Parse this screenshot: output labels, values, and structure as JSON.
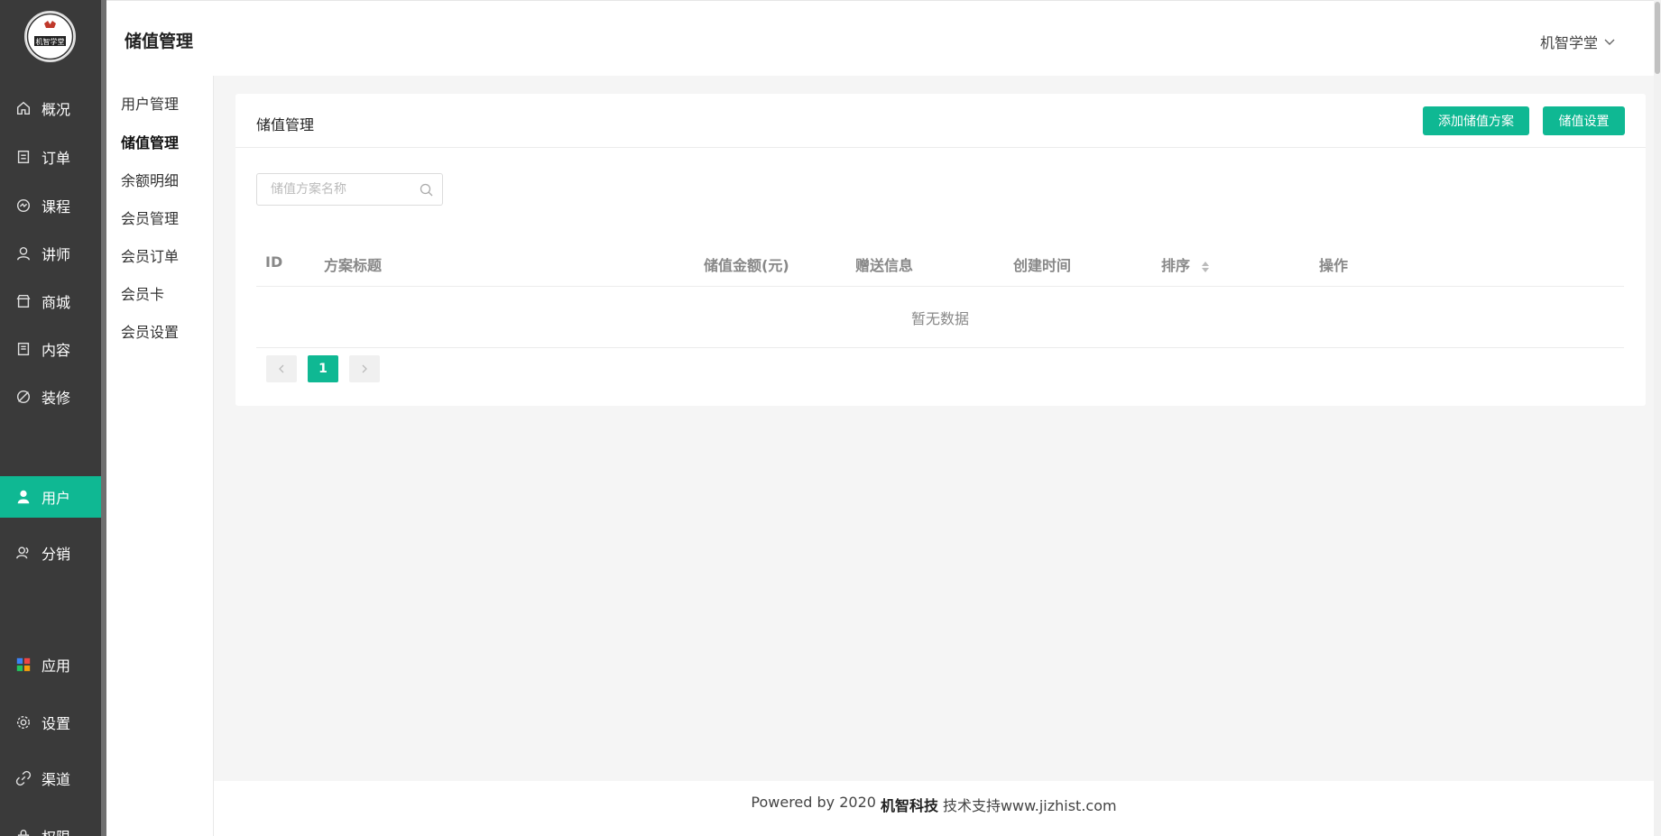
{
  "brand": {
    "logo_text": "机智学堂",
    "accent_color": "#0fb893",
    "nav_bg": "#3a3a3a"
  },
  "nav": {
    "items": [
      {
        "label": "概况",
        "icon": "home-icon"
      },
      {
        "label": "订单",
        "icon": "order-icon"
      },
      {
        "label": "课程",
        "icon": "course-icon"
      },
      {
        "label": "讲师",
        "icon": "teacher-icon"
      },
      {
        "label": "商城",
        "icon": "store-icon"
      },
      {
        "label": "内容",
        "icon": "content-icon"
      },
      {
        "label": "装修",
        "icon": "decorate-icon"
      },
      {
        "label": "用户",
        "icon": "user-icon",
        "active": true
      },
      {
        "label": "分销",
        "icon": "distribution-icon"
      },
      {
        "label": "应用",
        "icon": "apps-icon"
      },
      {
        "label": "设置",
        "icon": "gear-icon"
      },
      {
        "label": "渠道",
        "icon": "link-icon"
      },
      {
        "label": "权限",
        "icon": "lock-icon"
      }
    ]
  },
  "header": {
    "title": "储值管理",
    "user_name": "机智学堂"
  },
  "subnav": {
    "items": [
      {
        "label": "用户管理"
      },
      {
        "label": "储值管理",
        "active": true
      },
      {
        "label": "余额明细"
      },
      {
        "label": "会员管理"
      },
      {
        "label": "会员订单"
      },
      {
        "label": "会员卡"
      },
      {
        "label": "会员设置"
      }
    ]
  },
  "panel": {
    "title": "储值管理",
    "add_button": "添加储值方案",
    "settings_button": "储值设置",
    "search": {
      "value": "",
      "placeholder": "储值方案名称"
    },
    "table": {
      "columns": [
        "ID",
        "方案标题",
        "储值金额(元)",
        "赠送信息",
        "创建时间",
        "排序",
        "操作"
      ],
      "rows": [],
      "empty_text": "暂无数据"
    },
    "pagination": {
      "current_page": "1"
    }
  },
  "footer": {
    "prefix": "Powered by 2020",
    "company": "机智科技",
    "suffix": "技术支持www.jizhist.com"
  }
}
